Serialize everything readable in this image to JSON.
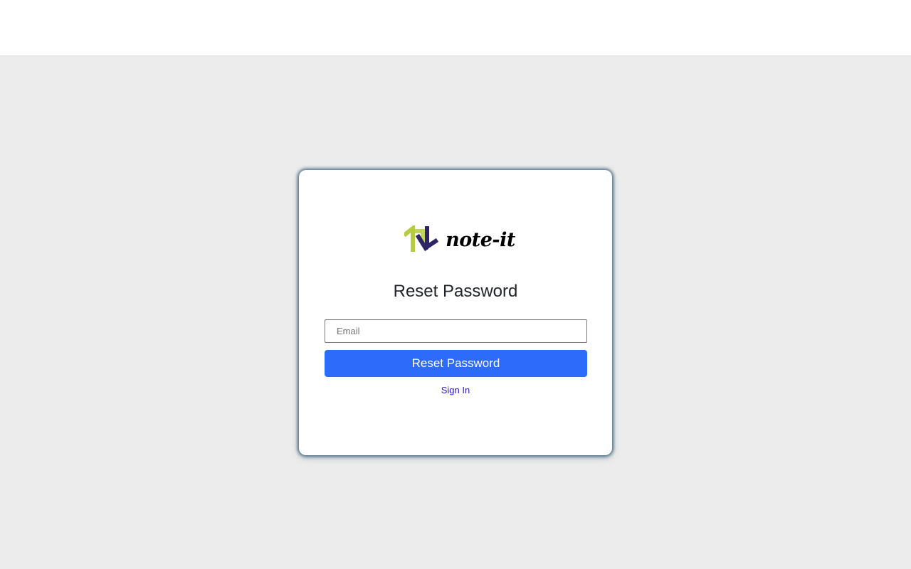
{
  "brand": {
    "name": "note-it",
    "logo_icon": "note-it-logo-icon",
    "logo_colors": {
      "primary": "#b5cc3c",
      "secondary": "#2d2566"
    }
  },
  "form": {
    "title": "Reset Password",
    "email_placeholder": "Email",
    "email_value": "",
    "submit_label": "Reset Password",
    "signin_link_label": "Sign In"
  },
  "colors": {
    "accent": "#2d6bfb",
    "link": "#2a1ac8",
    "background": "#ececec"
  }
}
